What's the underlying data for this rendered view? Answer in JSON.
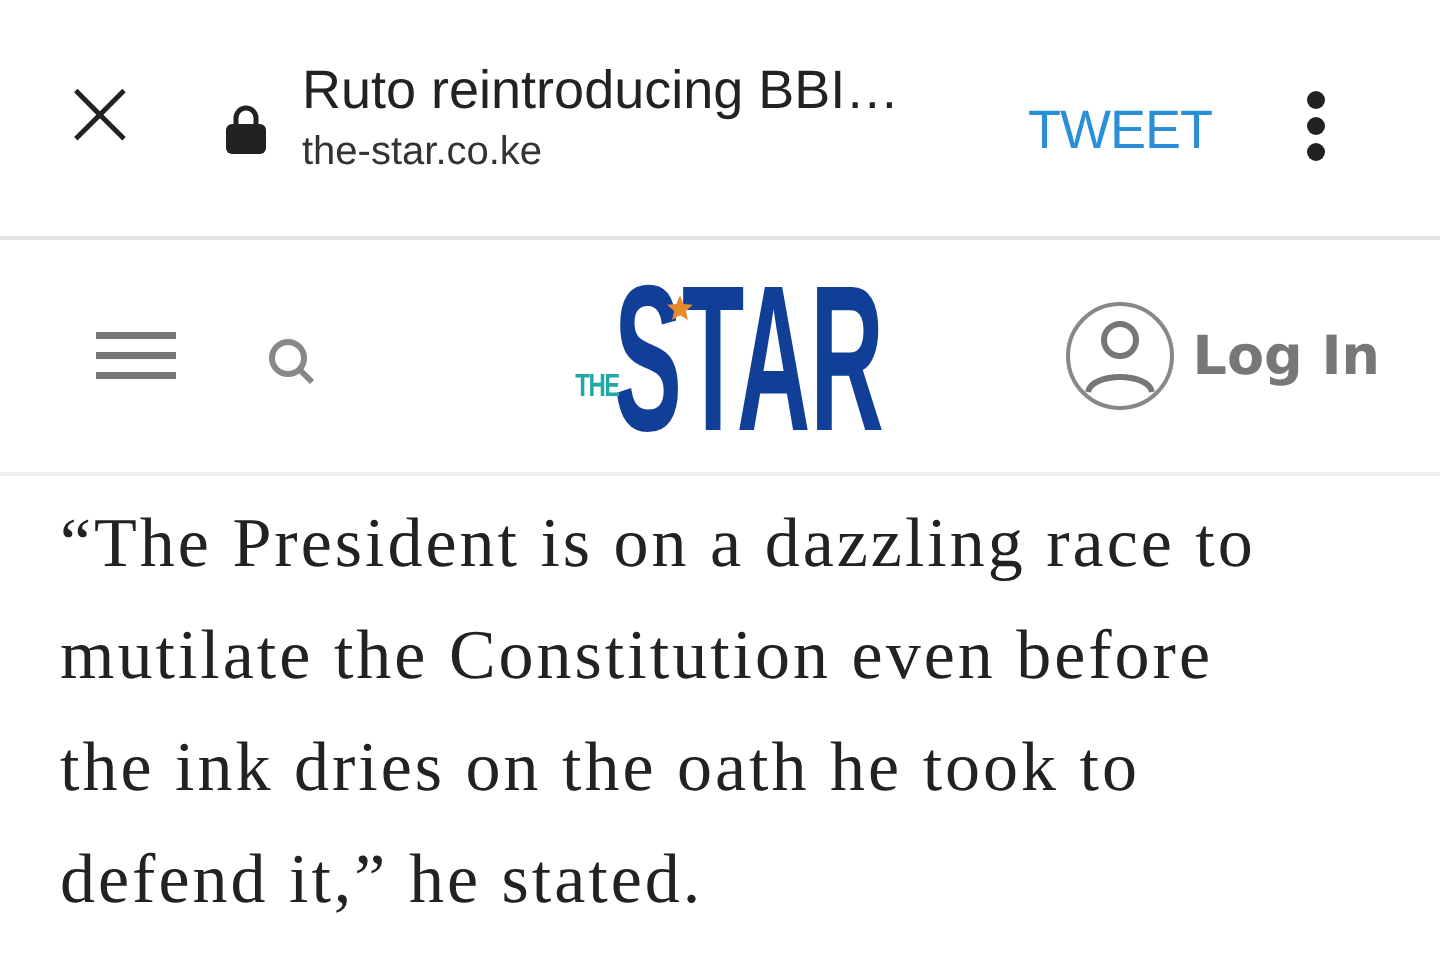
{
  "browser_bar": {
    "close": "×",
    "title": "Ruto reintroducing BBI…",
    "url": "the-star.co.ke",
    "action": "TWEET"
  },
  "site_header": {
    "logo": {
      "small": "THE",
      "main": "STAR"
    },
    "login": "Log In"
  },
  "article": {
    "paragraph": "“The President is on a dazzling race to mutilate the Constitution even before the ink dries on the oath he took to defend it,” he stated."
  }
}
